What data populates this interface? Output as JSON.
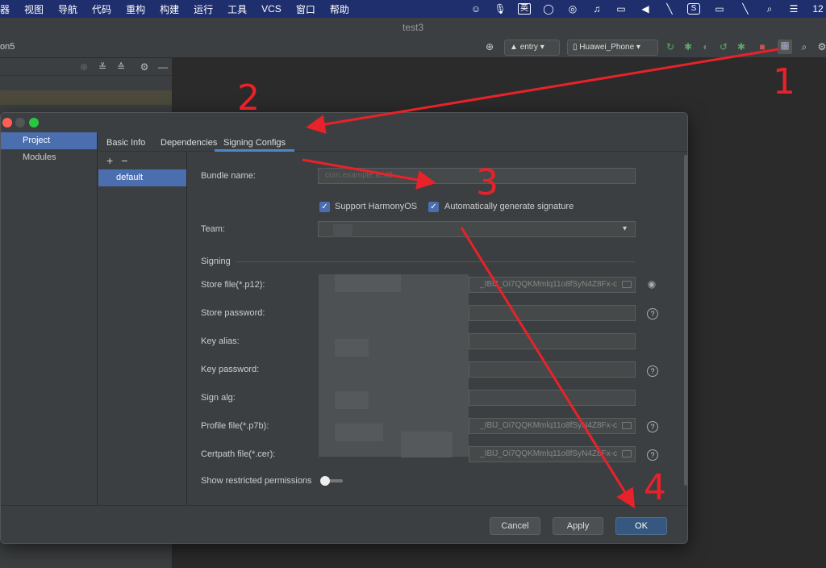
{
  "menubar": {
    "items": [
      "器",
      "视图",
      "导航",
      "代码",
      "重构",
      "构建",
      "运行",
      "工具",
      "VCS",
      "窗口",
      "帮助"
    ],
    "input_method": "英",
    "clock": "12"
  },
  "window": {
    "title": "test3"
  },
  "toolbar": {
    "project_name": "on5",
    "module_combo": "entry",
    "device_combo": "Huawei_Phone"
  },
  "dialog": {
    "nav": [
      "Project",
      "Modules"
    ],
    "tabs": [
      "Basic Info",
      "Dependencies",
      "Signing Configs"
    ],
    "config_list": {
      "add": "+",
      "remove": "−",
      "items": [
        "default"
      ]
    },
    "form": {
      "bundle_name_label": "Bundle name:",
      "bundle_name_value": "com.example.test3",
      "support_harmonyos": "Support HarmonyOS",
      "auto_signature": "Automatically generate signature",
      "team_label": "Team:",
      "signing_section": "Signing",
      "store_file_label": "Store file(*.p12):",
      "store_file_value": "_IBlJ_Oi7QQKMmlq11o8fSyN4Z8Fx-c",
      "store_password_label": "Store password:",
      "key_alias_label": "Key alias:",
      "key_password_label": "Key password:",
      "sign_alg_label": "Sign alg:",
      "profile_file_label": "Profile file(*.p7b):",
      "profile_file_value": "_IBlJ_Oi7QQKMmlq11o8fSyN4Z8Fx-c",
      "certpath_file_label": "Certpath file(*.cer):",
      "certpath_file_value": "_IBlJ_Oi7QQKMmlq11o8fSyN4Z8Fx-c",
      "show_restricted": "Show restricted permissions",
      "help_glyph": "?"
    },
    "buttons": {
      "cancel": "Cancel",
      "apply": "Apply",
      "ok": "OK"
    }
  },
  "annotations": {
    "n1": "1",
    "n2": "2",
    "n3": "3",
    "n4": "4",
    "color": "#e8222a"
  }
}
